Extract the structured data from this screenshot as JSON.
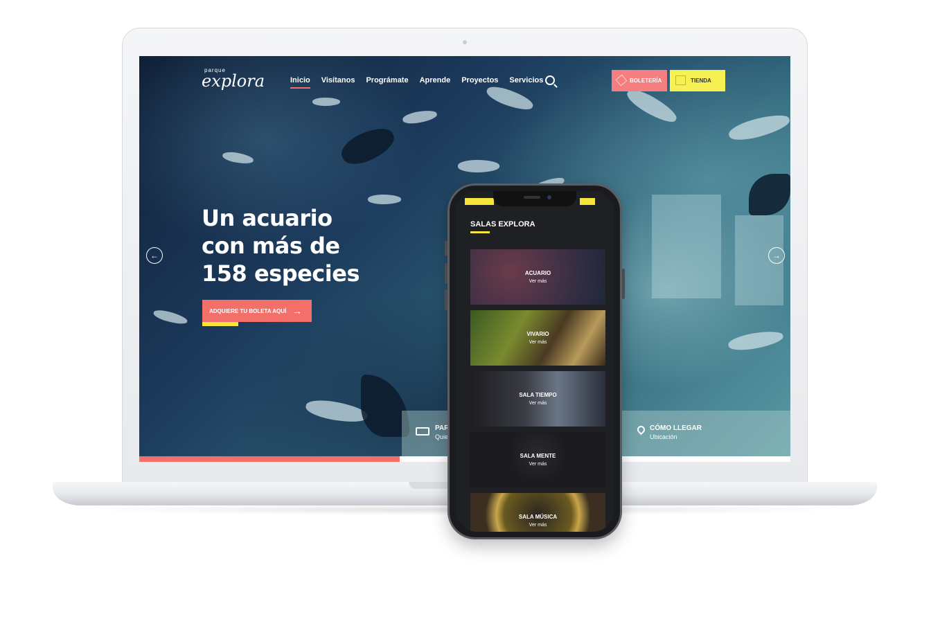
{
  "nav": {
    "logo_small": "parque",
    "logo_main": "explora",
    "links": [
      "Inicio",
      "Visítanos",
      "Prográmate",
      "Aprende",
      "Proyectos",
      "Servicios"
    ],
    "boleteria_label": "BOLETERÍA",
    "tienda_label": "TIENDA"
  },
  "hero": {
    "title_line1": "Un acuario",
    "title_line2": "con más de",
    "title_line3": "158 especies",
    "cta_label": "ADQUIERE TU BOLETA AQUÍ",
    "cta_arrow": "→"
  },
  "slider": {
    "prev_arrow": "←",
    "next_arrow": "→",
    "progress": 0.4
  },
  "info_bar": {
    "item1_title": "PAR",
    "item1_sub": "Quie",
    "item2_title": "CÓMO LLEGAR",
    "item2_sub": "Ubicación"
  },
  "phone": {
    "section_title": "SALAS EXPLORA",
    "cards": [
      {
        "name": "ACUARIO",
        "more": "Ver más"
      },
      {
        "name": "VIVARIO",
        "more": "Ver más"
      },
      {
        "name": "SALA TIEMPO",
        "more": "Ver más"
      },
      {
        "name": "SALA MENTE",
        "more": "Ver más"
      },
      {
        "name": "SALA MÚSICA",
        "more": "Ver más"
      }
    ]
  },
  "colors": {
    "coral": "#f36f6a",
    "yellow": "#f7e43c",
    "tienda_yellow": "#f7f052",
    "boleteria_pink": "#f47e80"
  }
}
